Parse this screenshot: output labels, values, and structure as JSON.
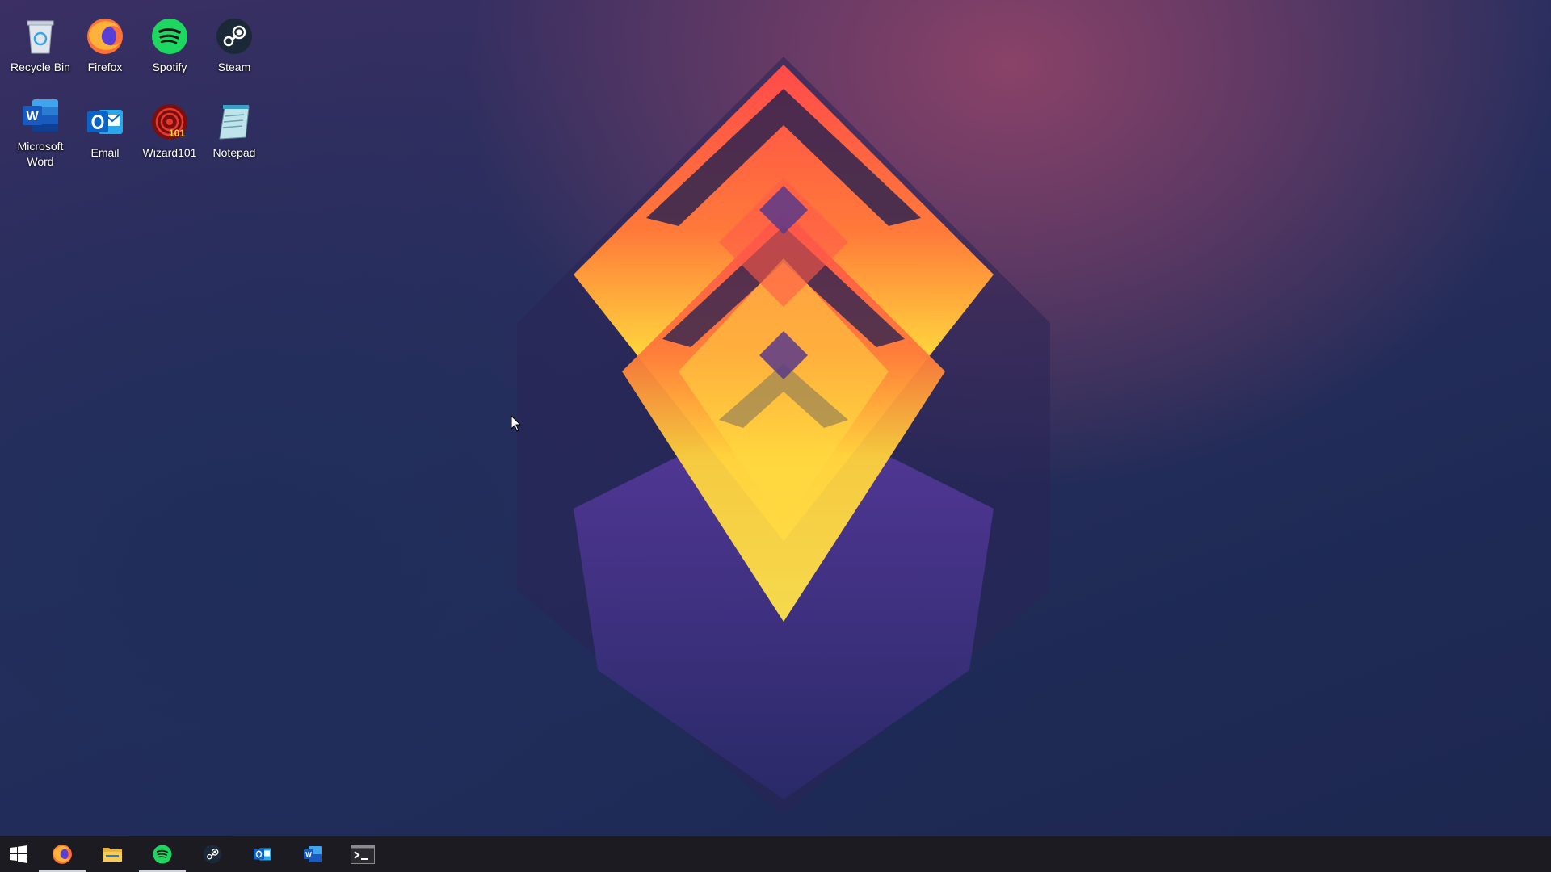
{
  "desktop": {
    "icons": [
      {
        "label": "Recycle Bin",
        "icon": "recycle-bin-icon"
      },
      {
        "label": "Firefox",
        "icon": "firefox-icon"
      },
      {
        "label": "Spotify",
        "icon": "spotify-icon"
      },
      {
        "label": "Steam",
        "icon": "steam-icon"
      },
      {
        "label": "Microsoft\nWord",
        "icon": "word-icon"
      },
      {
        "label": "Email",
        "icon": "outlook-icon"
      },
      {
        "label": "Wizard101",
        "icon": "wizard101-icon"
      },
      {
        "label": "Notepad",
        "icon": "notepad-icon"
      }
    ]
  },
  "taskbar": {
    "background": "#1b1b21",
    "buttons": [
      {
        "name": "start",
        "icon": "windows-logo-icon",
        "active": false
      },
      {
        "name": "firefox",
        "icon": "firefox-icon",
        "active": true
      },
      {
        "name": "file-explorer",
        "icon": "folder-icon",
        "active": false
      },
      {
        "name": "spotify",
        "icon": "spotify-icon",
        "active": true
      },
      {
        "name": "steam",
        "icon": "steam-icon",
        "active": false
      },
      {
        "name": "outlook",
        "icon": "outlook-icon",
        "active": false
      },
      {
        "name": "word",
        "icon": "word-icon",
        "active": false
      },
      {
        "name": "terminal",
        "icon": "terminal-icon",
        "active": false
      }
    ]
  },
  "colors": {
    "spotify": "#1ed760",
    "firefox": "#ff7139",
    "word": "#2b579a",
    "outlook": "#0a64c8",
    "steam": "#1b2838"
  }
}
